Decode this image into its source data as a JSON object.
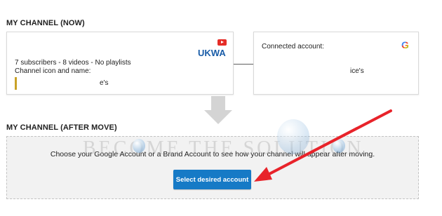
{
  "sections": {
    "now_label": "MY CHANNEL (NOW)",
    "after_label": "MY CHANNEL (AFTER MOVE)"
  },
  "channel_card": {
    "name": "UKWA",
    "stats": "7 subscribers - 8 videos - No playlists",
    "icon_and_name_label": "Channel icon and name:",
    "owner_name": "e's",
    "icon": "youtube-icon"
  },
  "account_card": {
    "connected_label": "Connected account:",
    "account_name": "ice's",
    "icon": "google-icon",
    "icon_glyph": "G"
  },
  "after_move": {
    "message": "Choose your Google Account or a Brand Account to see how your channel will appear after moving.",
    "button_label": "Select desired account"
  },
  "overlay": {
    "watermark": "BECOME THE SOLUTION",
    "arrow_color": "#e8232a"
  },
  "colors": {
    "accent": "#167ac6",
    "channel_name": "#1a5da8",
    "youtube_red": "#e52d27"
  }
}
